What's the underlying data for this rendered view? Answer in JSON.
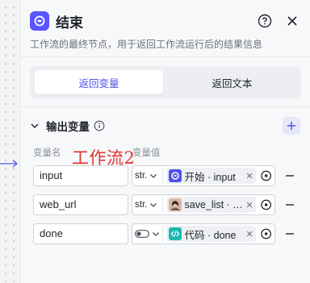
{
  "node": {
    "title": "结束",
    "description": "工作流的最终节点，用于返回工作流运行后的结果信息"
  },
  "tabs": [
    {
      "label": "返回变量",
      "active": true
    },
    {
      "label": "返回文本",
      "active": false
    }
  ],
  "output_section": {
    "title": "输出变量",
    "col_name": "变量名",
    "col_value": "变量值",
    "watermark": "工作流2"
  },
  "rows": [
    {
      "name": "input",
      "type": "str.",
      "ref_text": "开始 · input",
      "ref_icon": "start-node-icon"
    },
    {
      "name": "web_url",
      "type": "str.",
      "ref_text": "save_list · w…",
      "ref_icon": "avatar-icon"
    },
    {
      "name": "done",
      "type": "",
      "ref_text": "代码 · done",
      "ref_icon": "code-node-icon"
    }
  ],
  "colors": {
    "accent": "#4d53e8",
    "node_icon": "#5a55ff",
    "code_icon": "#1fb8b0",
    "watermark": "#e0332b"
  }
}
